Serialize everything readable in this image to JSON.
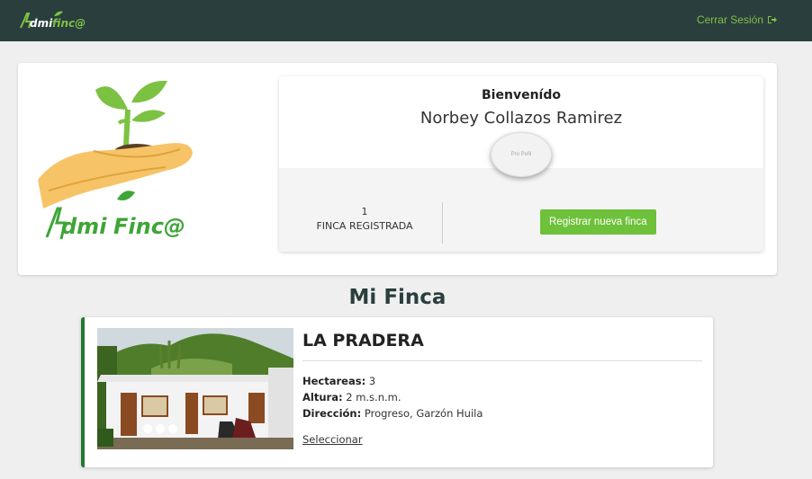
{
  "navbar": {
    "logo_text": "AdmiFinca",
    "logout_label": "Cerrar Sesión",
    "logout_icon": "sign-out-icon"
  },
  "profile": {
    "logo_text": "AdmiFinca",
    "welcome": "Bienvenído",
    "user_name": "Norbey Collazos Ramirez",
    "avatar_text": "Pro Pefil",
    "farm_count": "1",
    "farm_count_label": "FINCA REGISTRADA",
    "register_button": "Registrar nueva finca"
  },
  "section": {
    "title": "Mi Finca"
  },
  "farm": {
    "name": "LA PRADERA",
    "hectares_label": "Hectareas:",
    "hectares_value": "3",
    "altitude_label": "Altura:",
    "altitude_value": "2 m.s.n.m.",
    "address_label": "Dirección:",
    "address_value": "Progreso, Garzón Huila",
    "select_link": "Seleccionar"
  },
  "colors": {
    "navbar_bg": "#2b3e3e",
    "accent_green": "#6ec13a",
    "farm_border": "#1f7a2c"
  }
}
